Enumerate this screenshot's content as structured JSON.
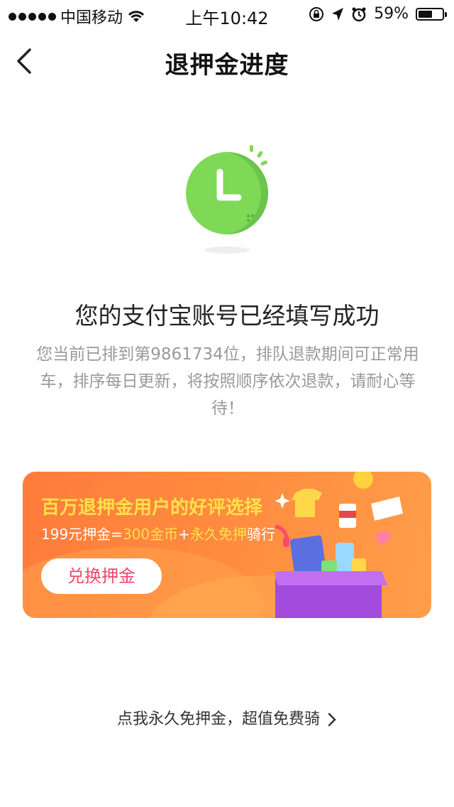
{
  "status_bar": {
    "carrier": "中国移动",
    "time": "上午10:42",
    "battery_percent": "59%",
    "battery_level": 0.59,
    "icons": [
      "signal-dots-icon",
      "wifi-icon",
      "rotation-lock-icon",
      "location-icon",
      "alarm-icon",
      "battery-icon"
    ]
  },
  "nav": {
    "title": "退押金进度",
    "back_icon": "back-chevron-icon"
  },
  "illustration": {
    "icon": "clock-icon",
    "colors": {
      "clock": "#7ed957",
      "clock_shadow": "#6cc44a",
      "ticks": "#7ed957"
    }
  },
  "main": {
    "headline": "您的支付宝账号已经填写成功",
    "description": "您当前已排到第9861734位，排队退款期间可正常用车，排序每日更新，将按照顺序依次退款，请耐心等待！"
  },
  "banner": {
    "title": "百万退押金用户的好评选择",
    "sub_part1": "199元押金=",
    "sub_part2": "300金币",
    "sub_part3": "+",
    "sub_part4": "永久免押",
    "sub_part5": "骑行",
    "button_label": "兑换押金",
    "colors": {
      "bg": "#ff8a3f",
      "highlight": "#ffe14a",
      "button_text": "#f2446a"
    }
  },
  "footer": {
    "link_label": "点我永久免押金，超值免费骑",
    "link_icon": "chevron-right-icon"
  }
}
